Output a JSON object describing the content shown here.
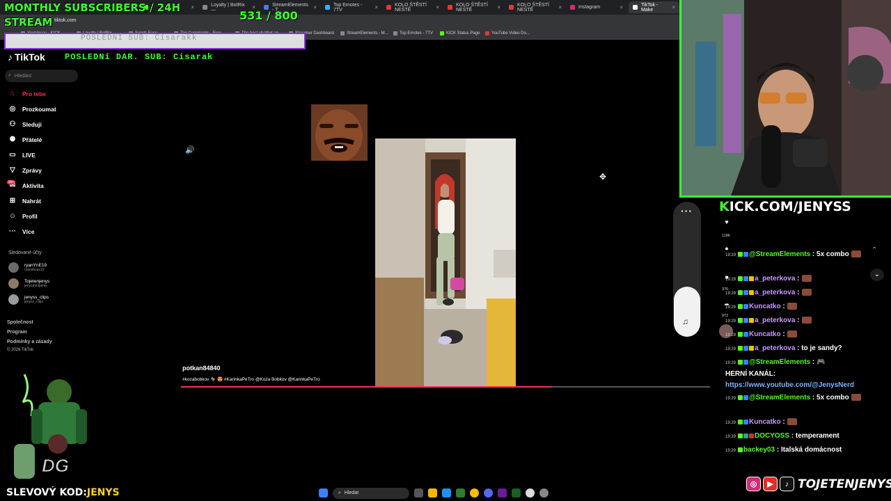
{
  "overlay": {
    "monthly_title": "MONTHLY SUBSCRIBERS / 24H STREAM",
    "sub_count": "531 / 800",
    "last_sub": "POSLEDNÍ SUB: Cisarakk",
    "last_dar": "POSLEDNí DAR. SUB: Cisarak",
    "kick_prefix": "K",
    "kick_url": "ICK.COM/JENYSS",
    "discount_label": "SLEVOVÝ KOD:",
    "discount_code": "JENYS",
    "social_handle": "TOJETENJENYS",
    "brand_green": "#3cff2b",
    "frame_green": "#3aff3a",
    "frame_purple": "#8a2be2"
  },
  "browser": {
    "url": "tiktok.com",
    "tabs": [
      {
        "label": "",
        "icon": "kick-icon"
      },
      {
        "label": "Loyalty | BotRix —",
        "icon": "botrix-icon"
      },
      {
        "label": "StreamElements - T",
        "icon": "streamelements-icon"
      },
      {
        "label": "Top Emotes - 7TV",
        "icon": "7tv-icon"
      },
      {
        "label": "KOLO ŠTĚSTÍ NEŠTĚ",
        "icon": "wheel-icon"
      },
      {
        "label": "KOLO ŠTĚSTÍ NEŠTĚ",
        "icon": "wheel-icon"
      },
      {
        "label": "KOLO ŠTĚSTÍ NEŠTĚ",
        "icon": "wheel-icon"
      },
      {
        "label": "Instagram",
        "icon": "instagram-icon"
      },
      {
        "label": "TikTok - Make",
        "icon": "tiktok-icon"
      }
    ],
    "bookmarks": [
      "Youtubeaн - KICK",
      "Loyalty | BotRix",
      "Sends Easy ...",
      "Top Complaints - Free",
      "The best chatbot an...",
      "Streamer Dashboard",
      "StreamElements - M...",
      "Top Emotes - 7TV",
      "KICK Status Page",
      "YouTube Video Do..."
    ]
  },
  "tiktok": {
    "logo": "TikTok",
    "search_placeholder": "Hledání",
    "nav": [
      {
        "label": "Pro tebe",
        "icon": "home-icon"
      },
      {
        "label": "Prozkoumat",
        "icon": "compass-icon"
      },
      {
        "label": "Sleduji",
        "icon": "following-icon"
      },
      {
        "label": "Přátelé",
        "icon": "friends-icon"
      },
      {
        "label": "LIVE",
        "icon": "live-icon"
      },
      {
        "label": "Zprávy",
        "icon": "send-icon"
      },
      {
        "label": "Aktivita",
        "icon": "activity-icon"
      },
      {
        "label": "Nahrát",
        "icon": "upload-icon"
      },
      {
        "label": "Profil",
        "icon": "profile-icon"
      },
      {
        "label": "Více",
        "icon": "more-icon"
      }
    ],
    "activity_badge": "99+",
    "followed_heading": "Sledované účty",
    "followed": [
      {
        "name": "ryanYnE19",
        "handle": "ryansboss19"
      },
      {
        "name": "Tojetenjenys",
        "handle": "jenysminipenis"
      },
      {
        "name": "jenyss_clips",
        "handle": "jenyss_clips"
      }
    ],
    "footer": [
      "Společnost",
      "Program",
      "Podmínky a zásady",
      "© 2026 TikTok"
    ],
    "video": {
      "username": "potkan84840",
      "description": "#kozabobkov 🐐 😍 #KarinkaPeTro @Koza Bobkov @KarinkaPeTro",
      "progress": 0.7
    },
    "actions": {
      "likes": "1186",
      "comments": "",
      "saves": "376",
      "shares": "972"
    }
  },
  "chat": [
    {
      "time": "19:29",
      "user": "@StreamElements",
      "text": "5x combo",
      "color": "#53fc18",
      "emote": true
    },
    {
      "time": "19:29",
      "user": "a_peterkova",
      "text": "",
      "color": "#c99aff",
      "emote": true
    },
    {
      "time": "19:29",
      "user": "a_peterkova",
      "text": "",
      "color": "#c99aff",
      "emote": true
    },
    {
      "time": "19:29",
      "user": "Kuncatko",
      "text": "",
      "color": "#c99aff",
      "emote": true
    },
    {
      "time": "19:29",
      "user": "a_peterkova",
      "text": "",
      "color": "#c99aff",
      "emote": true
    },
    {
      "time": "19:29",
      "user": "Kuncatko",
      "text": "",
      "color": "#c99aff",
      "emote": true
    },
    {
      "time": "19:29",
      "user": "a_peterkova",
      "text": "to je sandy?",
      "color": "#c99aff",
      "emote": false
    },
    {
      "time": "19:29",
      "user": "@StreamElements",
      "text": "HERNÍ KANÁL:",
      "link": "https://www.youtube.com/@JenysNerd",
      "color": "#53fc18",
      "emote": false
    },
    {
      "time": "19:29",
      "user": "@StreamElements",
      "text": "5x combo",
      "color": "#53fc18",
      "emote": true
    },
    {
      "time": "19:29",
      "user": "Kuncatko",
      "text": "",
      "color": "#c99aff",
      "emote": true
    },
    {
      "time": "19:29",
      "user": "DOCYOSS",
      "text": "temperament",
      "color": "#53fc18",
      "emote": false
    },
    {
      "time": "19:29",
      "user": "backey03",
      "text": "Italská domácnost",
      "color": "#53fc18",
      "emote": false
    }
  ],
  "taskbar": {
    "search_label": "Hledat"
  }
}
